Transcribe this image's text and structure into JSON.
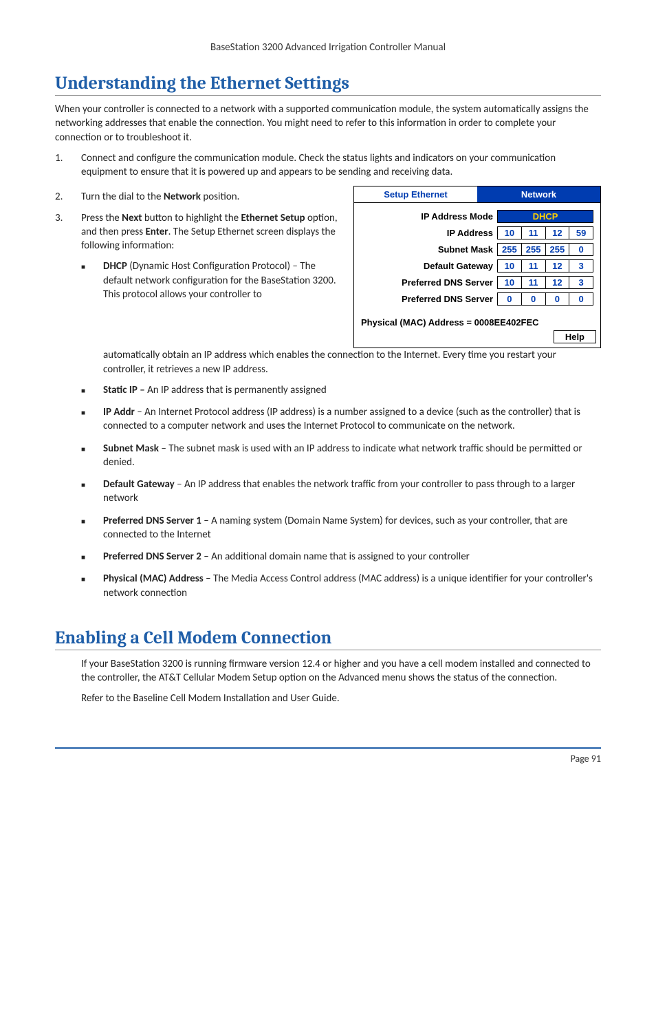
{
  "header": {
    "running_title": "BaseStation 3200 Advanced Irrigation Controller Manual"
  },
  "section1": {
    "title": "Understanding the Ethernet Settings",
    "intro": "When your controller is connected to a network with a supported communication module, the system automatically assigns the networking addresses that enable the connection. You might need to refer to this information in order to complete your connection or to troubleshoot it.",
    "steps": {
      "n1": "1.",
      "s1": "Connect and configure the communication module. Check the status lights and indicators on your communication equipment to ensure that it is powered up and appears to be sending and receiving data.",
      "n2": "2.",
      "s2_a": "Turn the dial to the ",
      "s2_b": "Network",
      "s2_c": " position.",
      "n3": "3.",
      "s3_a": "Press the ",
      "s3_b": "Next",
      "s3_c": " button to highlight the ",
      "s3_d": "Ethernet Setup",
      "s3_e": " option, and then press ",
      "s3_f": "Enter",
      "s3_g": ". The Setup Ethernet screen displays the following information:"
    },
    "bullets": {
      "b1_term": "DHCP",
      "b1_rest": " (Dynamic Host Configuration Protocol) – The default network configuration for the BaseStation 3200. This protocol allows your controller to automatically obtain an IP address which enables the connection to the Internet. Every time you restart your controller, it retrieves a new IP address.",
      "b2_term": "Static IP – ",
      "b2_rest": "An IP address that is permanently assigned",
      "b3_term": "IP Addr",
      "b3_rest": " – An Internet Protocol address (IP address) is a number assigned to a device (such as the controller) that is connected to a computer network and uses the Internet Protocol to communicate on the network.",
      "b4_term": "Subnet Mask",
      "b4_rest": " – The subnet mask is used with an IP address to indicate what network traffic should be permitted or denied.",
      "b5_term": "Default Gateway",
      "b5_rest": " – An IP address that enables the network traffic from your controller to pass through to a larger network",
      "b6_term": "Preferred DNS Server 1",
      "b6_rest": " – A naming system (Domain Name System) for devices, such as your controller, that are connected to the Internet",
      "b7_term": "Preferred DNS Server 2",
      "b7_rest": " – An additional domain name that is assigned to your controller",
      "b8_term": "Physical (MAC) Address",
      "b8_rest": " – The Media Access Control address (MAC address) is a unique identifier for your controller's network connection"
    }
  },
  "figure": {
    "tab_left": "Setup Ethernet",
    "tab_right": "Network",
    "rows": {
      "mode_label": "IP Address Mode",
      "mode_value": "DHCP",
      "ip_label": "IP Address",
      "ip_o1": "10",
      "ip_o2": "11",
      "ip_o3": "12",
      "ip_o4": "59",
      "mask_label": "Subnet Mask",
      "mask_o1": "255",
      "mask_o2": "255",
      "mask_o3": "255",
      "mask_o4": "0",
      "gw_label": "Default Gateway",
      "gw_o1": "10",
      "gw_o2": "11",
      "gw_o3": "12",
      "gw_o4": "3",
      "dns1_label": "Preferred DNS Server",
      "dns1_o1": "10",
      "dns1_o2": "11",
      "dns1_o3": "12",
      "dns1_o4": "3",
      "dns2_label": "Preferred DNS Server",
      "dns2_o1": "0",
      "dns2_o2": "0",
      "dns2_o3": "0",
      "dns2_o4": "0"
    },
    "mac_line": "Physical (MAC) Address = 0008EE402FEC",
    "help": "Help"
  },
  "section2": {
    "title": "Enabling a Cell Modem Connection",
    "p1": "If your BaseStation 3200 is running firmware version 12.4 or higher and you have a cell modem installed and connected to the controller, the AT&T Cellular Modem Setup option on the Advanced menu shows the status of the connection.",
    "p2": "Refer to the Baseline Cell Modem Installation and User Guide."
  },
  "footer": {
    "page": "Page 91"
  }
}
